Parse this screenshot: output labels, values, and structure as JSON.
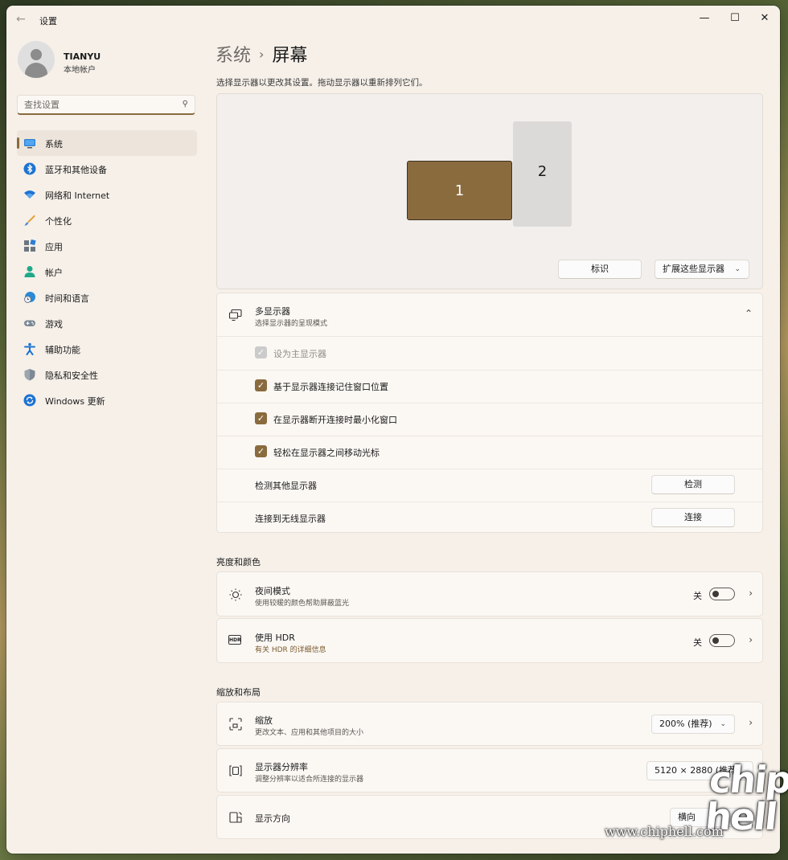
{
  "window": {
    "title": "设置",
    "back_icon": "arrow-left-icon",
    "min_glyph": "—",
    "max_glyph": "☐",
    "close_glyph": "✕"
  },
  "profile": {
    "name": "TIANYU",
    "account_type": "本地帐户"
  },
  "search": {
    "placeholder": "查找设置",
    "value": ""
  },
  "sidebar": {
    "items": [
      {
        "label": "系统",
        "icon": "monitor-icon",
        "active": true
      },
      {
        "label": "蓝牙和其他设备",
        "icon": "bluetooth-icon"
      },
      {
        "label": "网络和 Internet",
        "icon": "wifi-icon"
      },
      {
        "label": "个性化",
        "icon": "brush-icon"
      },
      {
        "label": "应用",
        "icon": "apps-icon"
      },
      {
        "label": "帐户",
        "icon": "person-icon"
      },
      {
        "label": "时间和语言",
        "icon": "globe-clock-icon"
      },
      {
        "label": "游戏",
        "icon": "gamepad-icon"
      },
      {
        "label": "辅助功能",
        "icon": "accessibility-icon"
      },
      {
        "label": "隐私和安全性",
        "icon": "shield-icon"
      },
      {
        "label": "Windows 更新",
        "icon": "update-icon"
      }
    ]
  },
  "breadcrumb": {
    "parent": "系统",
    "separator": "›",
    "current": "屏幕"
  },
  "arrange": {
    "description": "选择显示器以更改其设置。拖动显示器以重新排列它们。",
    "monitor1": "1",
    "monitor2": "2",
    "identify_label": "标识",
    "extend_value": "扩展这些显示器",
    "accent_color": "#8a6b3e"
  },
  "multi_display": {
    "title": "多显示器",
    "subtitle": "选择显示器的呈现模式",
    "options": [
      {
        "label": "设为主显示器",
        "checked": true,
        "disabled": true
      },
      {
        "label": "基于显示器连接记住窗口位置",
        "checked": true
      },
      {
        "label": "在显示器断开连接时最小化窗口",
        "checked": true
      },
      {
        "label": "轻松在显示器之间移动光标",
        "checked": true
      }
    ],
    "detect": {
      "label": "检测其他显示器",
      "button": "检测"
    },
    "wireless": {
      "label": "连接到无线显示器",
      "button": "连接"
    }
  },
  "brightness_section": {
    "title": "亮度和颜色",
    "night_light": {
      "title": "夜间模式",
      "subtitle": "使用较暖的颜色帮助屏蔽蓝光",
      "state": "关"
    },
    "hdr": {
      "title": "使用 HDR",
      "subtitle": "有关 HDR 的详细信息",
      "state": "关",
      "icon_text": "HDR"
    }
  },
  "scale_section": {
    "title": "缩放和布局",
    "scale": {
      "title": "缩放",
      "subtitle": "更改文本、应用和其他项目的大小",
      "value": "200% (推荐)"
    },
    "resolution": {
      "title": "显示器分辨率",
      "subtitle": "调整分辨率以适合所连接的显示器",
      "value": "5120 × 2880 (推荐)"
    },
    "orientation": {
      "title": "显示方向",
      "value": "横向"
    }
  },
  "watermark": {
    "site": "www.chiphell.com",
    "logo": "chip hell"
  }
}
